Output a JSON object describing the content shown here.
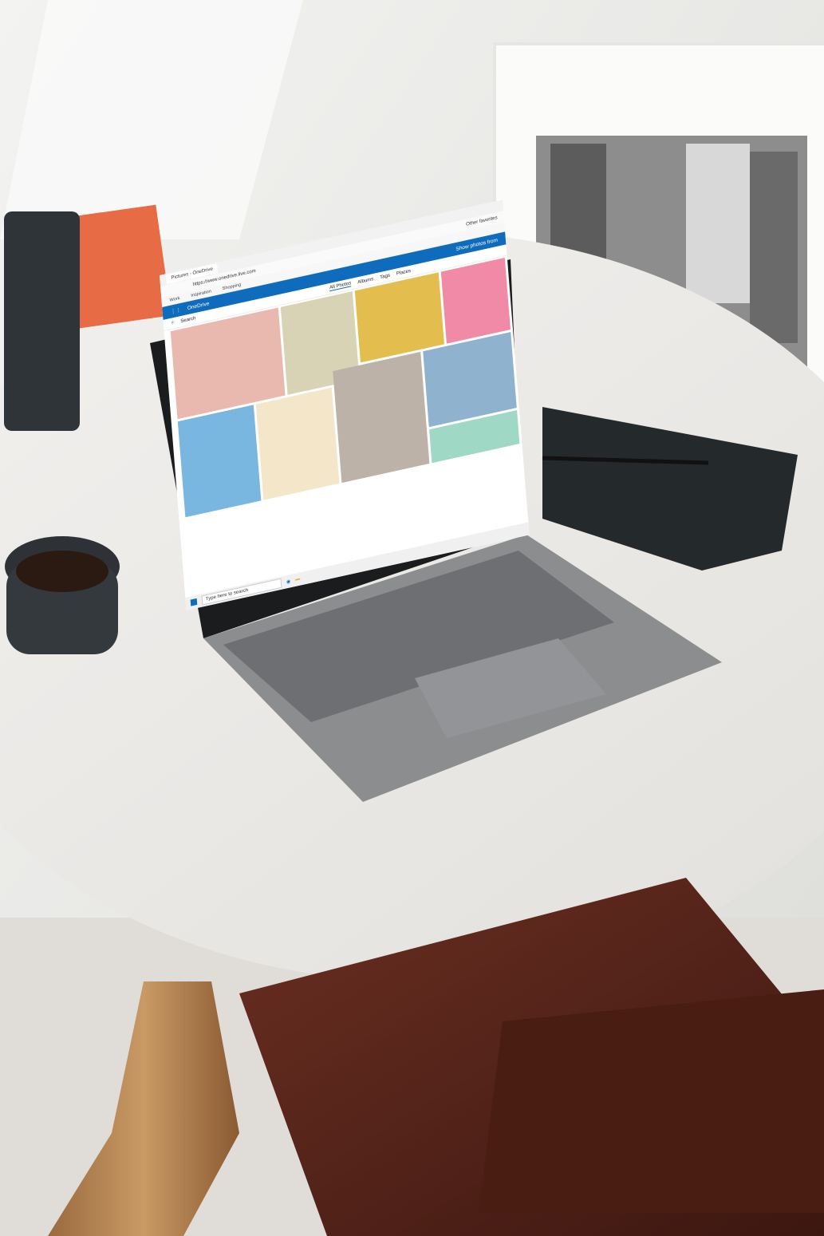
{
  "browser": {
    "tab_title": "Pictures - OneDrive",
    "url": "https://www.onedrive.live.com",
    "favorites": [
      "Work",
      "Inspiration",
      "Shopping"
    ],
    "other_favorites": "Other favorites"
  },
  "onedrive": {
    "app_name": "OneDrive",
    "search_placeholder": "Search",
    "tabs": [
      "All Photos",
      "Albums",
      "Tags",
      "Places"
    ],
    "show_photos_from": "Show photos from"
  },
  "taskbar": {
    "search_placeholder": "Type here to search"
  },
  "colors": {
    "onedrive_blue": "#0f6cbd"
  }
}
